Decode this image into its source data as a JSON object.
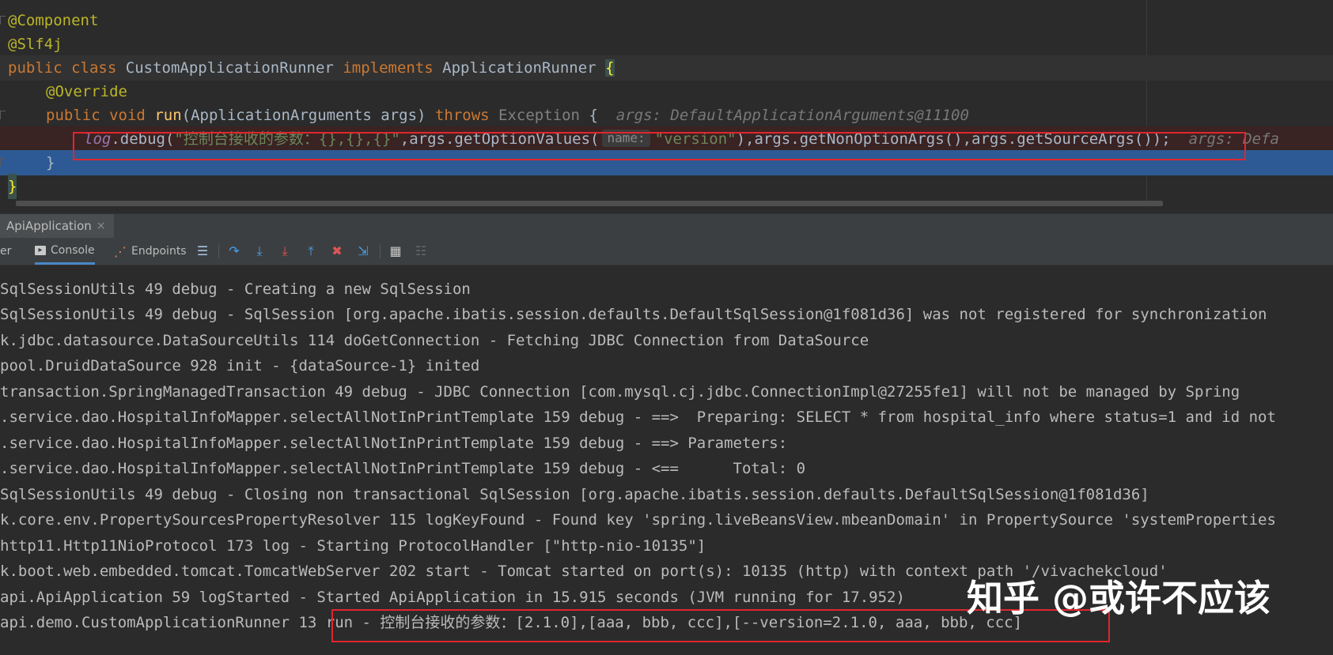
{
  "editor": {
    "lines": {
      "l1": "@Component",
      "l2": "@Slf4j",
      "l3": {
        "kw1": "public",
        "kw2": "class",
        "name": "CustomApplicationRunner",
        "kw3": "implements",
        "iface": "ApplicationRunner",
        "brace": "{"
      },
      "l4": "@Override",
      "l5": {
        "kw1": "public",
        "kw2": "void",
        "method": "run",
        "params": "(ApplicationArguments args)",
        "kw3": "throws",
        "exc": "Exception",
        "brace": "{",
        "hint": "args: DefaultApplicationArguments@11100"
      },
      "l6": {
        "log": "log",
        "call1": ".debug(",
        "str1": "\"控制台接收的参数：{},{},{}\"",
        "call2": ",args.getOptionValues(",
        "param_hint": "name:",
        "str2": "\"version\"",
        "call3": "),args.getNonOptionArgs(),args.getSourceArgs());",
        "hint": "args: Defa"
      },
      "l7": "}",
      "l8": "}"
    }
  },
  "run_tab": {
    "label": "ApiApplication",
    "close": "×"
  },
  "toolbar": {
    "partial_label": "er",
    "console_label": "Console",
    "endpoints_label": "Endpoints"
  },
  "console": {
    "lines": [
      "SqlSessionUtils 49 debug - Creating a new SqlSession",
      "SqlSessionUtils 49 debug - SqlSession [org.apache.ibatis.session.defaults.DefaultSqlSession@1f081d36] was not registered for synchronization",
      "k.jdbc.datasource.DataSourceUtils 114 doGetConnection - Fetching JDBC Connection from DataSource",
      "pool.DruidDataSource 928 init - {dataSource-1} inited",
      "transaction.SpringManagedTransaction 49 debug - JDBC Connection [com.mysql.cj.jdbc.ConnectionImpl@27255fe1] will not be managed by Spring",
      ".service.dao.HospitalInfoMapper.selectAllNotInPrintTemplate 159 debug - ==>  Preparing: SELECT * from hospital_info where status=1 and id not",
      ".service.dao.HospitalInfoMapper.selectAllNotInPrintTemplate 159 debug - ==> Parameters: ",
      ".service.dao.HospitalInfoMapper.selectAllNotInPrintTemplate 159 debug - <==      Total: 0",
      "SqlSessionUtils 49 debug - Closing non transactional SqlSession [org.apache.ibatis.session.defaults.DefaultSqlSession@1f081d36]",
      "k.core.env.PropertySourcesPropertyResolver 115 logKeyFound - Found key 'spring.liveBeansView.mbeanDomain' in PropertySource 'systemProperties",
      "http11.Http11NioProtocol 173 log - Starting ProtocolHandler [\"http-nio-10135\"]",
      "k.boot.web.embedded.tomcat.TomcatWebServer 202 start - Tomcat started on port(s): 10135 (http) with context path '/vivachekcloud'",
      "api.ApiApplication 59 logStarted - Started ApiApplication in 15.915 seconds (JVM running for 17.952)",
      "api.demo.CustomApplicationRunner 13 run - 控制台接收的参数：[2.1.0],[aaa, bbb, ccc],[--version=2.1.0, aaa, bbb, ccc]"
    ]
  },
  "watermark": "知乎 @或许不应该",
  "colors": {
    "editor_bg": "#2b2b2b",
    "panel_bg": "#3c3f41",
    "selection": "#2d5a95",
    "annotation": "#bbb529",
    "keyword": "#cc7832",
    "string": "#6a8759",
    "method": "#ffc66d",
    "highlight_box": "#e0262d"
  },
  "icons": [
    "console-icon",
    "endpoints-icon",
    "menu-icon",
    "step-over-icon",
    "step-into-icon",
    "force-step-into-icon",
    "step-out-icon",
    "drop-frame-icon",
    "run-to-cursor-icon",
    "evaluate-icon",
    "trace-icon"
  ]
}
